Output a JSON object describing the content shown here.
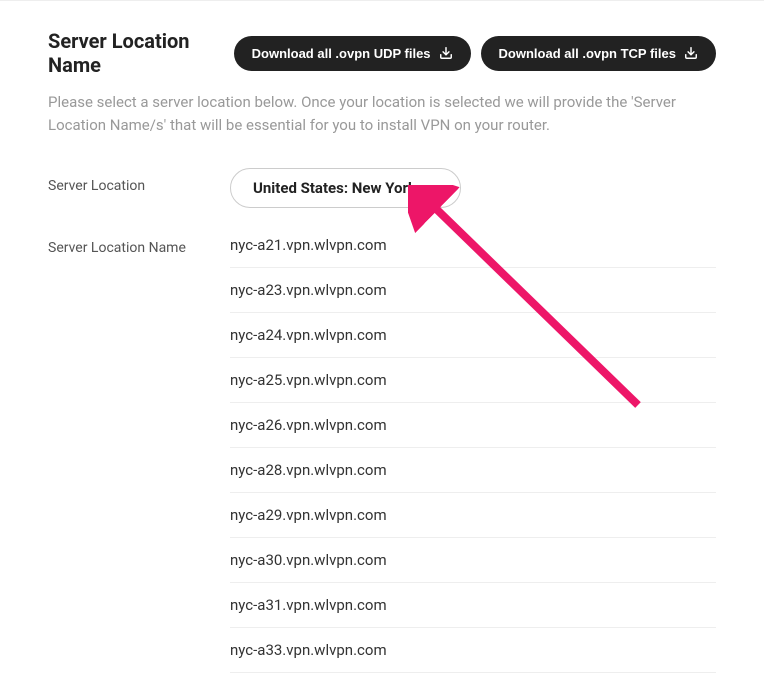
{
  "header": {
    "title": "Server Location Name",
    "download_udp_label": "Download all .ovpn UDP files",
    "download_tcp_label": "Download all .ovpn TCP files"
  },
  "description": "Please select a server location below. Once your location is selected we will provide the 'Server Location Name/s' that will be essential for you to install VPN on your router.",
  "labels": {
    "server_location": "Server Location",
    "server_location_name": "Server Location Name"
  },
  "select": {
    "value": "United States: New York"
  },
  "servers": [
    "nyc-a21.vpn.wlvpn.com",
    "nyc-a23.vpn.wlvpn.com",
    "nyc-a24.vpn.wlvpn.com",
    "nyc-a25.vpn.wlvpn.com",
    "nyc-a26.vpn.wlvpn.com",
    "nyc-a28.vpn.wlvpn.com",
    "nyc-a29.vpn.wlvpn.com",
    "nyc-a30.vpn.wlvpn.com",
    "nyc-a31.vpn.wlvpn.com",
    "nyc-a33.vpn.wlvpn.com"
  ],
  "annotation": {
    "arrow_color": "#ed1668"
  }
}
